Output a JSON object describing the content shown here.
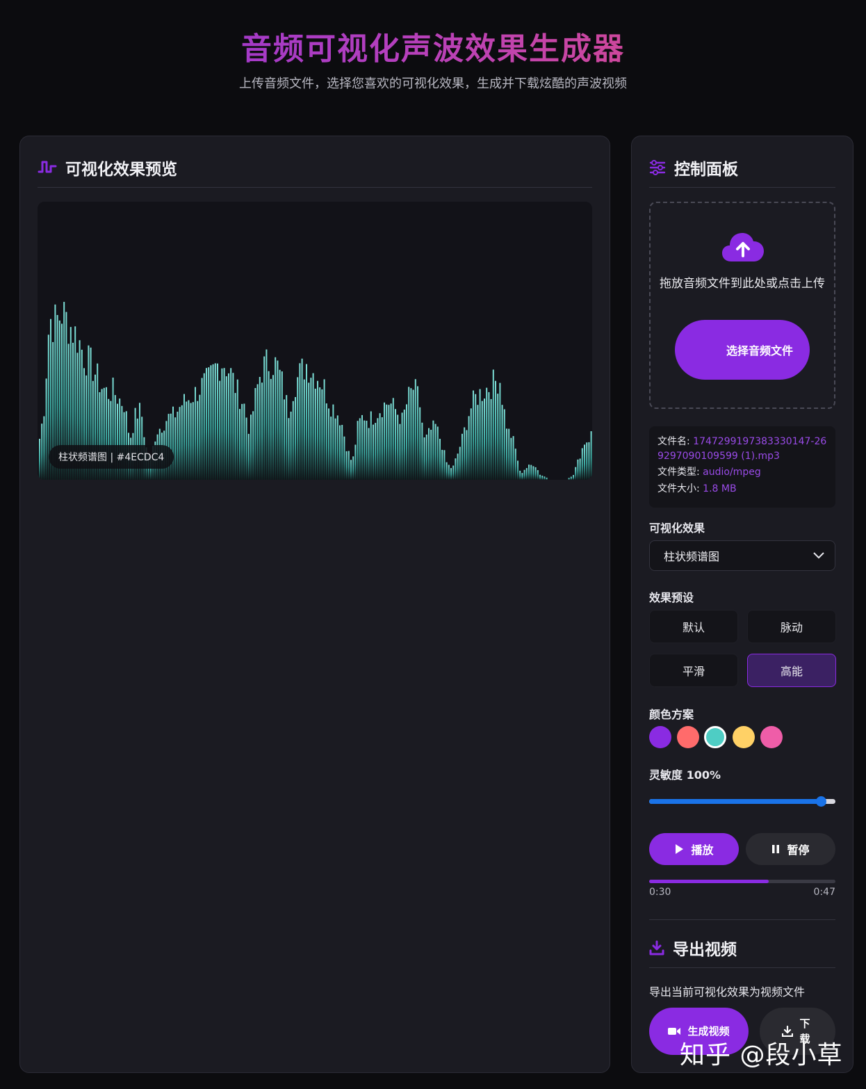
{
  "header": {
    "title": "音频可视化声波效果生成器",
    "subtitle": "上传音频文件，选择您喜欢的可视化效果，生成并下载炫酷的声波视频"
  },
  "preview": {
    "title": "可视化效果预览",
    "title_icon": "waveform-icon",
    "tag": "柱状频谱图 | #4ECDC4",
    "bar_color": "#4ECDC4"
  },
  "controls": {
    "title": "控制面板",
    "title_icon": "sliders-icon",
    "upload": {
      "icon": "cloud-upload-icon",
      "text": "拖放音频文件到此处或点击上传",
      "button": "选择音频文件"
    },
    "file": {
      "name_label": "文件名:",
      "name": "1747299197383330147-269297090109599 (1).mp3",
      "type_label": "文件类型:",
      "type": "audio/mpeg",
      "size_label": "文件大小:",
      "size": "1.8 MB"
    },
    "effect": {
      "label": "可视化效果",
      "selected": "柱状频谱图"
    },
    "presets": {
      "label": "效果预设",
      "items": [
        "默认",
        "脉动",
        "平滑",
        "高能"
      ],
      "active": "高能"
    },
    "colors": {
      "label": "颜色方案",
      "swatches": [
        "#8A2BE2",
        "#FF6B6B",
        "#4ECDC4",
        "#FFD166",
        "#EF5DA8"
      ],
      "selected": "#4ECDC4"
    },
    "sensitivity": {
      "label": "灵敏度 100%",
      "value": 100,
      "fraction": 0.92
    },
    "playback": {
      "play": "播放",
      "pause": "暂停",
      "current": "0:30",
      "total": "0:47",
      "progress": 0.64
    },
    "export": {
      "title": "导出视频",
      "title_icon": "download-icon",
      "description": "导出当前可视化效果为视频文件",
      "generate": "生成视频",
      "download": "下载"
    }
  },
  "watermark": "知乎 @段小草"
}
